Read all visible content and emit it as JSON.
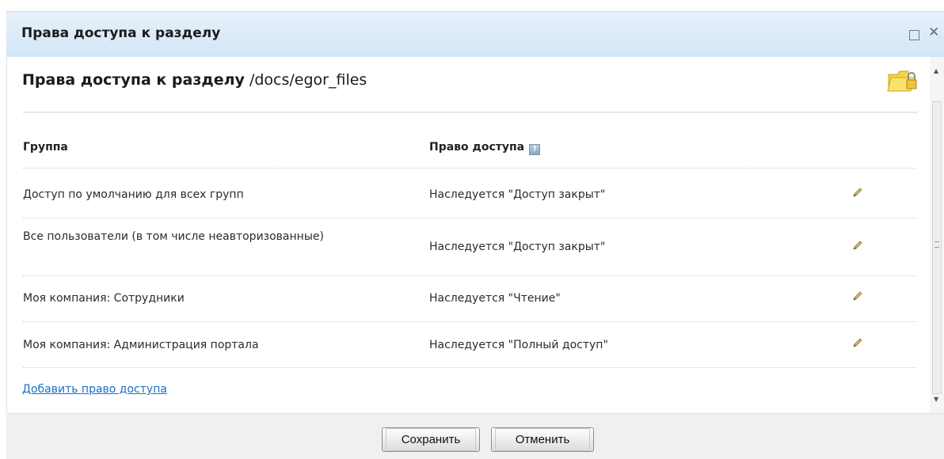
{
  "dialog": {
    "title": "Права доступа к разделу"
  },
  "content": {
    "heading_bold": "Права доступа к разделу",
    "heading_path": "/docs/egor_files",
    "columns": {
      "group": "Группа",
      "access": "Право доступа"
    },
    "rows": [
      {
        "group": "Доступ по умолчанию для всех групп",
        "access": "Наследуется \"Доступ закрыт\""
      },
      {
        "group": "Все пользователи (в том числе неавторизованные)",
        "access": "Наследуется \"Доступ закрыт\""
      },
      {
        "group": "Моя компания: Сотрудники",
        "access": "Наследуется \"Чтение\""
      },
      {
        "group": "Моя компания: Администрация портала",
        "access": "Наследуется \"Полный доступ\""
      }
    ],
    "add_link": "Добавить право доступа"
  },
  "footer": {
    "save_label": "Сохранить",
    "cancel_label": "Отменить"
  },
  "icons": {
    "folder": "folder-lock-icon",
    "help": "help-icon",
    "edit": "pencil-icon",
    "maximize": "maximize-icon",
    "close": "close-icon"
  },
  "colors": {
    "titlebar": "#d3e5f6",
    "link": "#1a6fc4",
    "footer": "#f0f0f0"
  }
}
